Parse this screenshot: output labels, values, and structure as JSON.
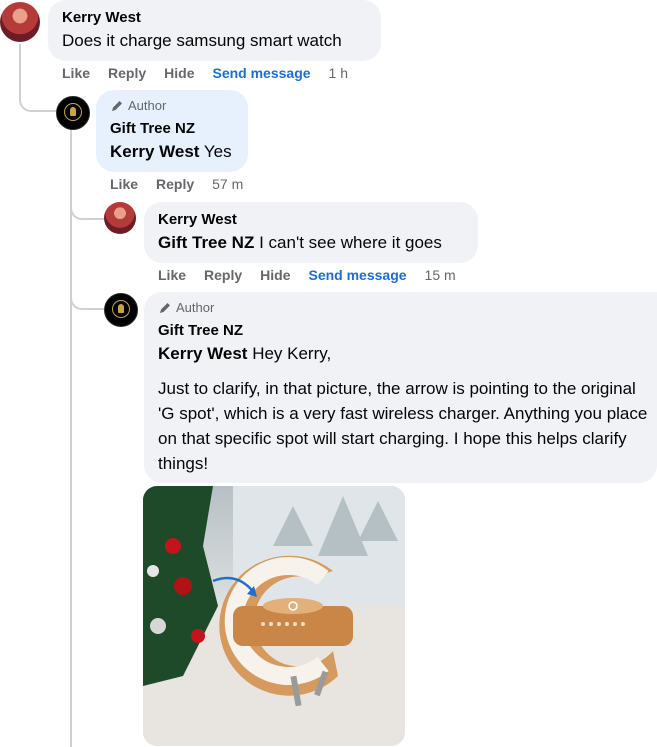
{
  "comments": [
    {
      "author": "Kerry West",
      "text": "Does it charge samsung smart watch",
      "actions": {
        "like": "Like",
        "reply": "Reply",
        "hide": "Hide",
        "send": "Send message",
        "time": "1 h"
      }
    },
    {
      "author_badge": "Author",
      "author": "Gift Tree NZ",
      "mention": "Kerry West",
      "text": "Yes",
      "actions": {
        "like": "Like",
        "reply": "Reply",
        "time": "57 m"
      }
    },
    {
      "author": "Kerry West",
      "mention": "Gift Tree NZ",
      "text": "I can't see where it goes",
      "actions": {
        "like": "Like",
        "reply": "Reply",
        "hide": "Hide",
        "send": "Send message",
        "time": "15 m"
      }
    },
    {
      "author_badge": "Author",
      "author": "Gift Tree NZ",
      "mention": "Kerry West",
      "text": "Hey Kerry,",
      "paragraph": "Just to clarify, in that picture, the arrow is pointing to the original 'G spot', which is a very fast wireless charger. Anything you place on that specific spot will start charging. I hope this helps clarify things!"
    }
  ],
  "colors": {
    "bubble": "#f0f2f5",
    "author_bubble": "#e7f1fd",
    "link": "#1a6ed8",
    "meta": "#65676b"
  },
  "icons": {
    "author_badge": "pencil-icon"
  }
}
